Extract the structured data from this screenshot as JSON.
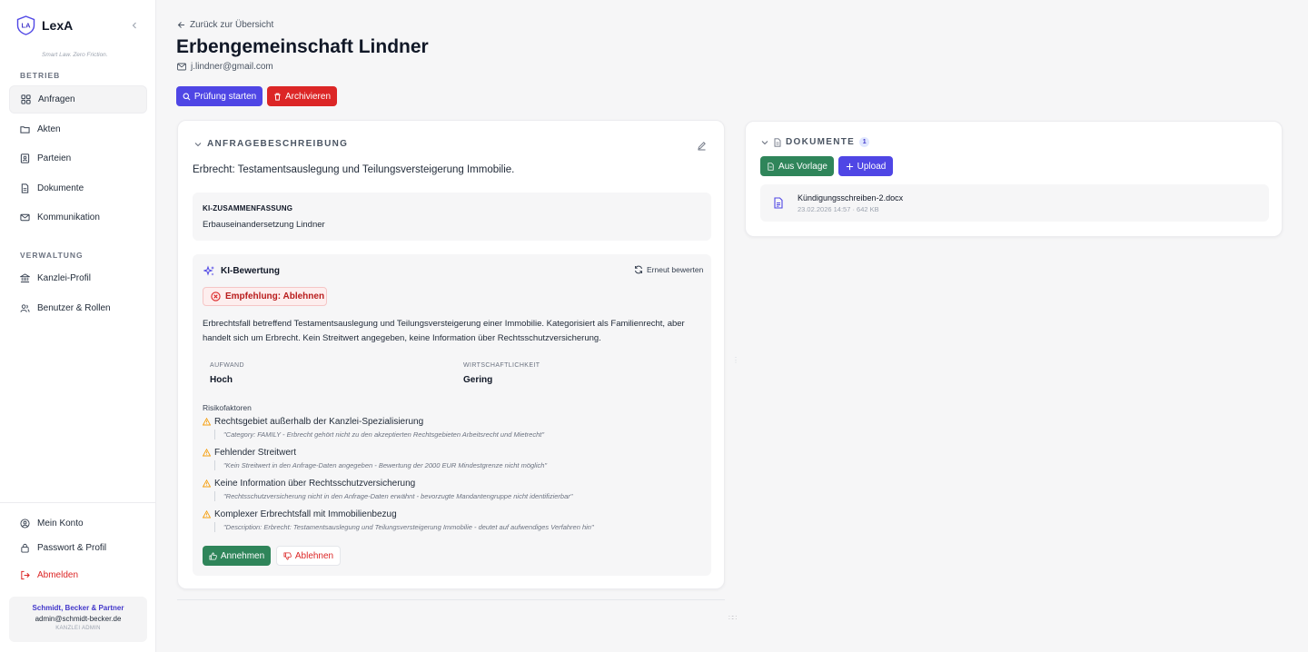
{
  "colors": {
    "accent": "#4f46e5",
    "danger": "#dc2626",
    "success": "#2f855a",
    "warning": "#f59e0b"
  },
  "sidebar": {
    "app_name": "LexA",
    "logo_text": "LA",
    "tagline": "Smart Law. Zero Friction.",
    "section_operations": "BETRIEB",
    "section_admin": "VERWALTUNG",
    "items": [
      {
        "label": "Anfragen",
        "icon": "grid-icon",
        "active": true
      },
      {
        "label": "Akten",
        "icon": "folder-icon"
      },
      {
        "label": "Parteien",
        "icon": "contact-icon"
      },
      {
        "label": "Dokumente",
        "icon": "document-icon"
      },
      {
        "label": "Kommunikation",
        "icon": "mail-icon"
      },
      {
        "label": "Kanzlei-Profil",
        "icon": "bank-icon"
      },
      {
        "label": "Benutzer & Rollen",
        "icon": "users-icon"
      }
    ],
    "footer_items": [
      {
        "label": "Mein Konto",
        "icon": "user-circle-icon"
      },
      {
        "label": "Passwort & Profil",
        "icon": "lock-icon"
      },
      {
        "label": "Abmelden",
        "icon": "logout-icon"
      }
    ],
    "account": {
      "org": "Schmidt, Becker & Partner",
      "email": "admin@schmidt-becker.de",
      "role": "KANZLEI ADMIN"
    }
  },
  "header": {
    "back_label": "Zurück zur Übersicht",
    "title": "Erbengemeinschaft Lindner",
    "email": "j.lindner@gmail.com",
    "start_check_label": "Prüfung starten",
    "archive_label": "Archivieren"
  },
  "request": {
    "section_title": "ANFRAGEBESCHREIBUNG",
    "description": "Erbrecht: Testamentsauslegung und Teilungsversteigerung Immobilie.",
    "summary_heading": "KI-ZUSAMMENFASSUNG",
    "summary_text": "Erbauseinandersetzung Lindner"
  },
  "evaluation": {
    "title": "KI-Bewertung",
    "reassess_label": "Erneut bewerten",
    "recommendation": "Empfehlung: Ablehnen",
    "text": "Erbrechtsfall betreffend Testamentsauslegung und Teilungsversteigerung einer Immobilie. Kategorisiert als Familienrecht, aber handelt sich um Erbrecht. Kein Streitwert angegeben, keine Information über Rechtsschutzversicherung.",
    "effort_label": "AUFWAND",
    "effort_value": "Hoch",
    "economy_label": "WIRTSCHAFTLICHKEIT",
    "economy_value": "Gering",
    "risk_title": "Risikofaktoren",
    "risks": [
      {
        "title": "Rechtsgebiet außerhalb der Kanzlei-Spezialisierung",
        "quote": "\"Category: FAMILY - Erbrecht gehört nicht zu den akzeptierten Rechtsgebieten Arbeitsrecht und Mietrecht\""
      },
      {
        "title": "Fehlender Streitwert",
        "quote": "\"Kein Streitwert in den Anfrage-Daten angegeben - Bewertung der 2000 EUR Mindestgrenze nicht möglich\""
      },
      {
        "title": "Keine Information über Rechtsschutzversicherung",
        "quote": "\"Rechtsschutzversicherung nicht in den Anfrage-Daten erwähnt - bevorzugte Mandantengruppe nicht identifizierbar\""
      },
      {
        "title": "Komplexer Erbrechtsfall mit Immobilienbezug",
        "quote": "\"Description: Erbrecht: Testamentsauslegung und Teilungsversteigerung Immobilie - deutet auf aufwendiges Verfahren hin\""
      }
    ],
    "accept_label": "Annehmen",
    "decline_label": "Ablehnen"
  },
  "documents": {
    "section_title": "DOKUMENTE",
    "count": "1",
    "template_label": "Aus Vorlage",
    "upload_label": "Upload",
    "files": [
      {
        "name": "Kündigungsschreiben-2.docx",
        "meta": "23.02.2026 14:57 · 642 KB"
      }
    ]
  }
}
